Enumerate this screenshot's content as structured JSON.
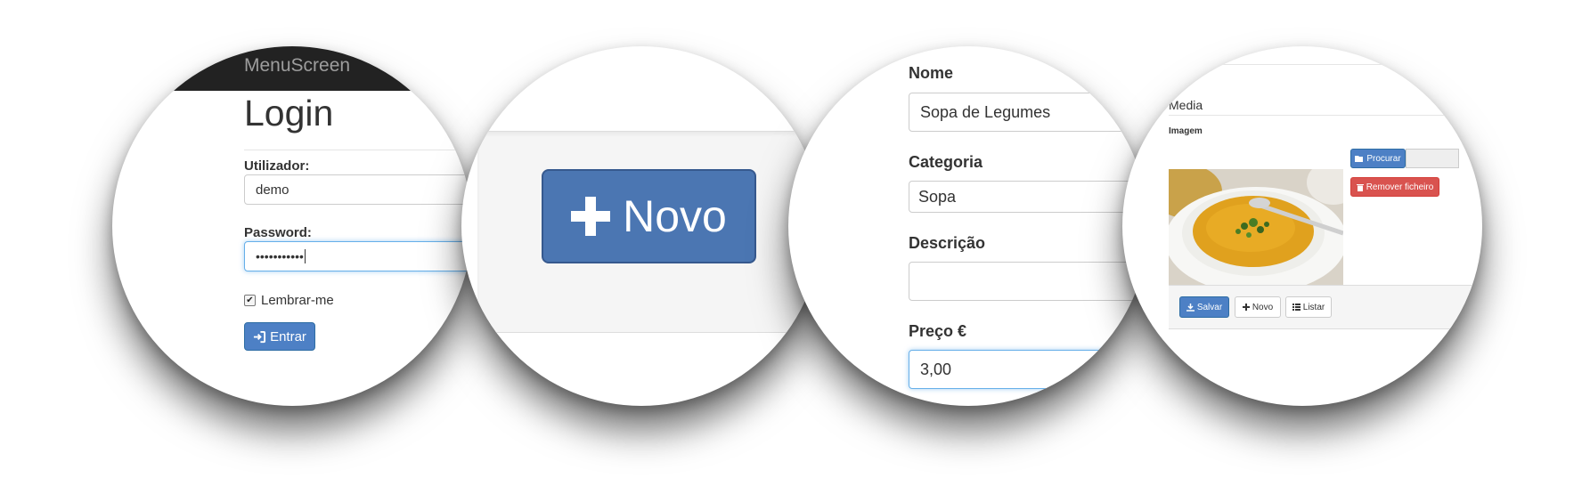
{
  "login": {
    "brand": "MenuScreen",
    "title": "Login",
    "username_label": "Utilizador:",
    "username_value": "demo",
    "password_label": "Password:",
    "password_value": "•••••••••••",
    "remember_label": "Lembrar-me",
    "submit_label": "Entrar"
  },
  "toolbar_zoom": {
    "new_label": "Novo"
  },
  "form": {
    "name_label": "Nome",
    "name_value": "Sopa de Legumes",
    "category_label": "Categoria",
    "category_value": "Sopa",
    "description_label": "Descrição",
    "description_value": "",
    "price_label": "Preço €",
    "price_value": "3,00"
  },
  "media": {
    "section_label": "Media",
    "image_label": "Imagem",
    "browse_label": "Procurar",
    "remove_label": "Remover ficheiro",
    "save_label": "Salvar",
    "new_label": "Novo",
    "list_label": "Listar"
  },
  "colors": {
    "primary": "#4d80c5",
    "danger": "#d9534f",
    "navbar": "#222222"
  },
  "icons": {
    "login": "sign-in-icon",
    "plus": "plus-icon",
    "folder": "folder-open-icon",
    "trash": "trash-icon",
    "download": "download-icon",
    "list": "list-icon"
  }
}
